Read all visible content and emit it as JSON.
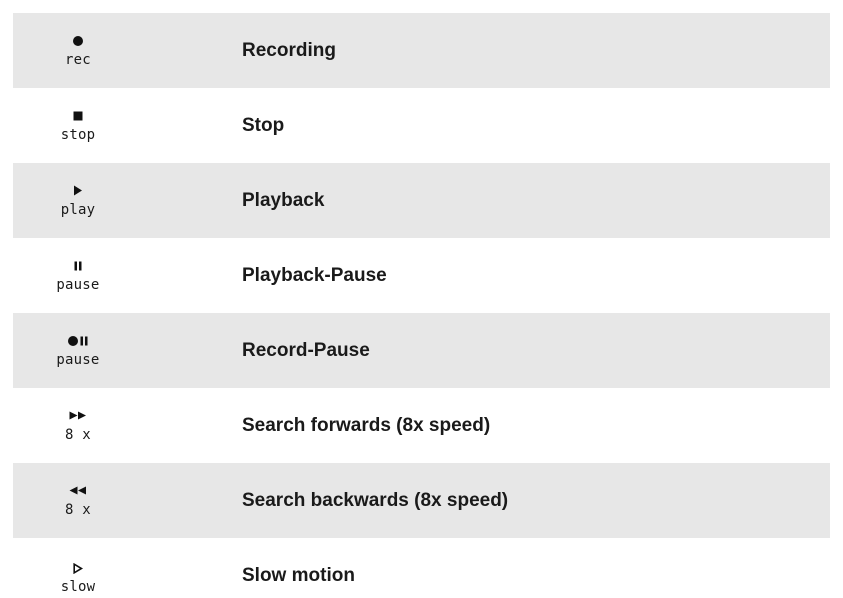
{
  "rows": [
    {
      "icon": "record-dot-icon",
      "mode": "rec",
      "label": "Recording"
    },
    {
      "icon": "stop-square-icon",
      "mode": "stop",
      "label": "Stop"
    },
    {
      "icon": "play-triangle-icon",
      "mode": "play",
      "label": "Playback"
    },
    {
      "icon": "pause-bars-icon",
      "mode": "pause",
      "label": "Playback-Pause"
    },
    {
      "icon": "record-pause-icon",
      "mode": "pause",
      "label": "Record-Pause"
    },
    {
      "icon": "fast-forward-icon",
      "mode": "8 x",
      "label": "Search forwards (8x speed)"
    },
    {
      "icon": "rewind-icon",
      "mode": "8 x",
      "label": "Search backwards (8x speed)"
    },
    {
      "icon": "slow-play-outline-icon",
      "mode": "slow",
      "label": "Slow motion"
    }
  ]
}
